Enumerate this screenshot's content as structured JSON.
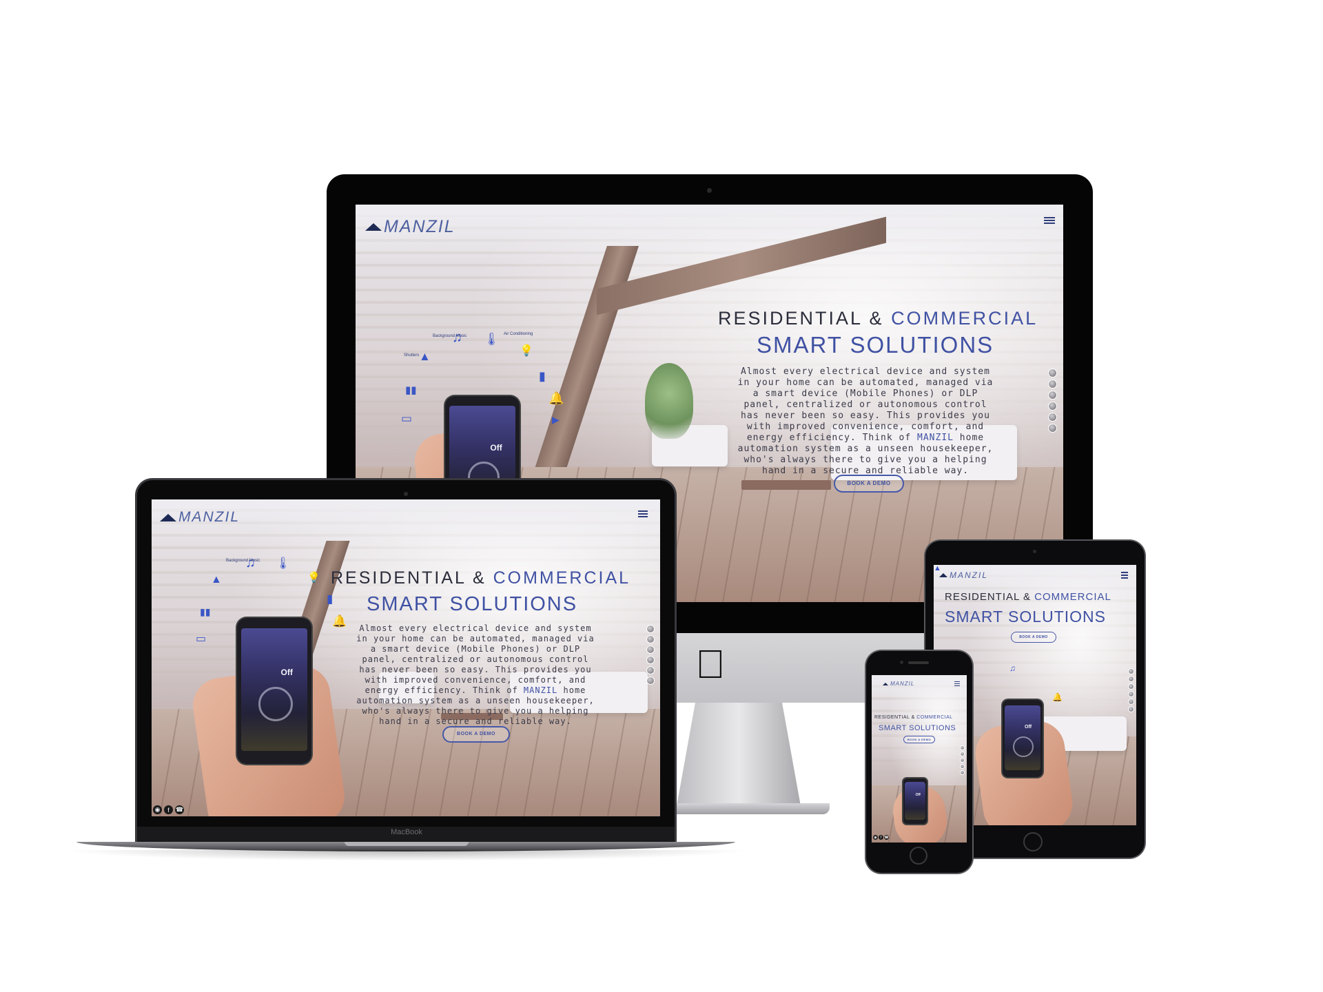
{
  "brand": {
    "logo_text": "MANZIL"
  },
  "hero": {
    "line1_part1": "RESIDENTIAL &",
    "line1_part2": "COMMERCIAL",
    "line2": "SMART SOLUTIONS",
    "body_1": "Almost every electrical device and system in your home can be automated, managed via a smart device (Mobile Phones) or DLP panel, centralized or autonomous control has never been so easy. This provides you with improved convenience, comfort, and energy efficiency. Think of ",
    "body_highlight": "MANZIL",
    "body_2": " home automation system as a unseen housekeeper, who's always there to give you a helping hand in a secure and reliable way.",
    "cta_label": "BOOK A DEMO"
  },
  "devices": {
    "laptop_label": "MacBook"
  },
  "phone_ui": {
    "status": "Off",
    "logo": "MANZIL"
  },
  "iot_labels": {
    "background_music": "Background Music",
    "air_conditioning": "Air Conditioning",
    "lighting": "Lighting",
    "shutters": "Shutters",
    "energy_monitoring": "Energy Monitoring",
    "home_cinema": "Home Cinema",
    "alarm": "Security",
    "cctv": "CCTV"
  },
  "icons": {
    "menu": "hamburger-menu-icon",
    "instagram": "instagram-icon",
    "facebook": "facebook-icon",
    "phone": "phone-icon",
    "apple": "apple-logo-icon"
  },
  "colors": {
    "accent": "#3f51a3",
    "dark_text": "#2a2c3a",
    "frame": "#050505"
  }
}
